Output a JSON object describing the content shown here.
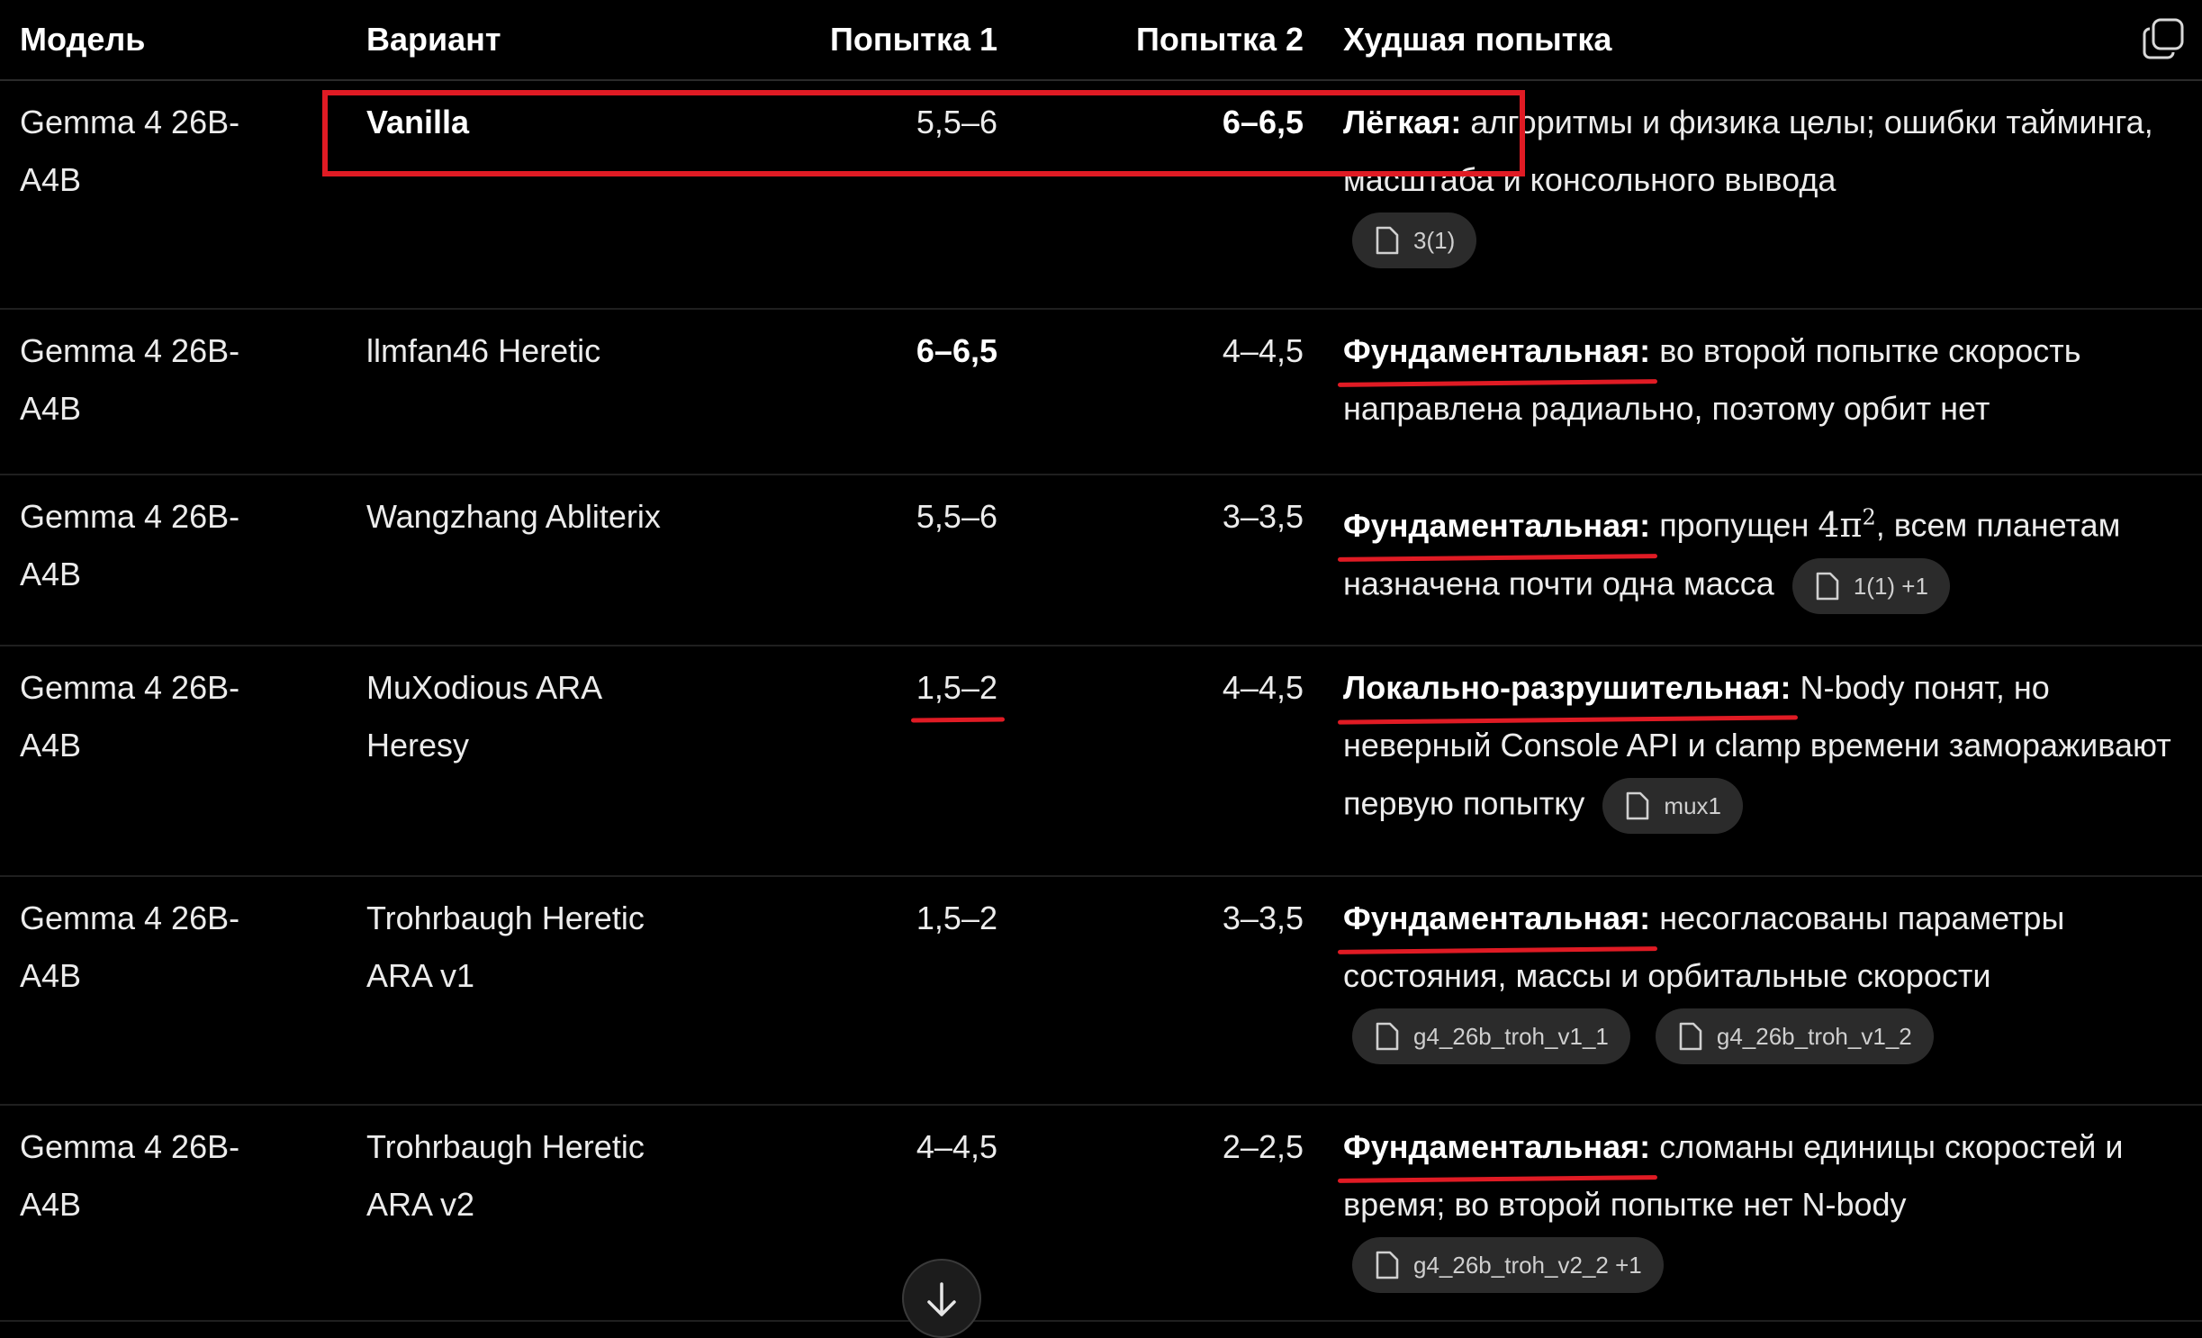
{
  "headers": {
    "model": "Модель",
    "variant": "Вариант",
    "attempt1": "Попытка 1",
    "attempt2": "Попытка 2",
    "worst": "Худшая попытка"
  },
  "rows": [
    {
      "model_line1": "Gemma 4 26B-",
      "model_line2": "A4B",
      "variant": "Vanilla",
      "variant_bold": true,
      "attempt1": "5,5–6",
      "attempt2": "6–6,5",
      "attempt2_bold": true,
      "worst_label": "Лёгкая:",
      "worst_text": " алгоритмы и физика целы; ошибки тайминга, масштаба и консольного вывода",
      "chips": [
        "3(1)"
      ]
    },
    {
      "model_line1": "Gemma 4 26B-",
      "model_line2": "A4B",
      "variant": "llmfan46 Heretic",
      "attempt1": "6–6,5",
      "attempt1_bold": true,
      "attempt2": "4–4,5",
      "worst_label": "Фундаментальная:",
      "worst_text": " во второй попытке скорость направлена радиально, поэтому орбит нет",
      "chips": []
    },
    {
      "model_line1": "Gemma 4 26B-",
      "model_line2": "A4B",
      "variant": "Wangzhang Abliterix",
      "attempt1": "5,5–6",
      "attempt2": "3–3,5",
      "worst_label": "Фундаментальная:",
      "worst_text_a": " пропущен ",
      "worst_math": "4π",
      "worst_sup": "2",
      "worst_text_b": ", всем планетам назначена почти одна масса",
      "chips": [
        "1(1) +1"
      ]
    },
    {
      "model_line1": "Gemma 4 26B-",
      "model_line2": "A4B",
      "variant_line1": "MuXodious ARA",
      "variant_line2": "Heresy",
      "attempt1": "1,5–2",
      "attempt2": "4–4,5",
      "worst_label": "Локально-разрушительная:",
      "worst_text": " N-body понят, но неверный Console API и clamp времени замораживают первую попытку",
      "chips": [
        "mux1"
      ]
    },
    {
      "model_line1": "Gemma 4 26B-",
      "model_line2": "A4B",
      "variant_line1": "Trohrbaugh Heretic",
      "variant_line2": "ARA v1",
      "attempt1": "1,5–2",
      "attempt2": "3–3,5",
      "worst_label": "Фундаментальная:",
      "worst_text": " несогласованы параметры состояния, массы и орбитальные скорости",
      "chips": [
        "g4_26b_troh_v1_1",
        "g4_26b_troh_v1_2"
      ]
    },
    {
      "model_line1": "Gemma 4 26B-",
      "model_line2": "A4B",
      "variant_line1": "Trohrbaugh Heretic",
      "variant_line2": "ARA v2",
      "attempt1": "4–4,5",
      "attempt2": "2–2,5",
      "worst_label": "Фундаментальная:",
      "worst_text": " сломаны единицы скоростей и время; во второй попытке нет N-body",
      "chips": [
        "g4_26b_troh_v2_2 +1"
      ]
    }
  ],
  "icons": {
    "copy": "copy-icon",
    "file": "file-icon",
    "scroll": "arrow-down-icon"
  },
  "colors": {
    "background": "#000000",
    "accent_red": "#e01b24",
    "chip_bg": "#2b2b2b"
  }
}
